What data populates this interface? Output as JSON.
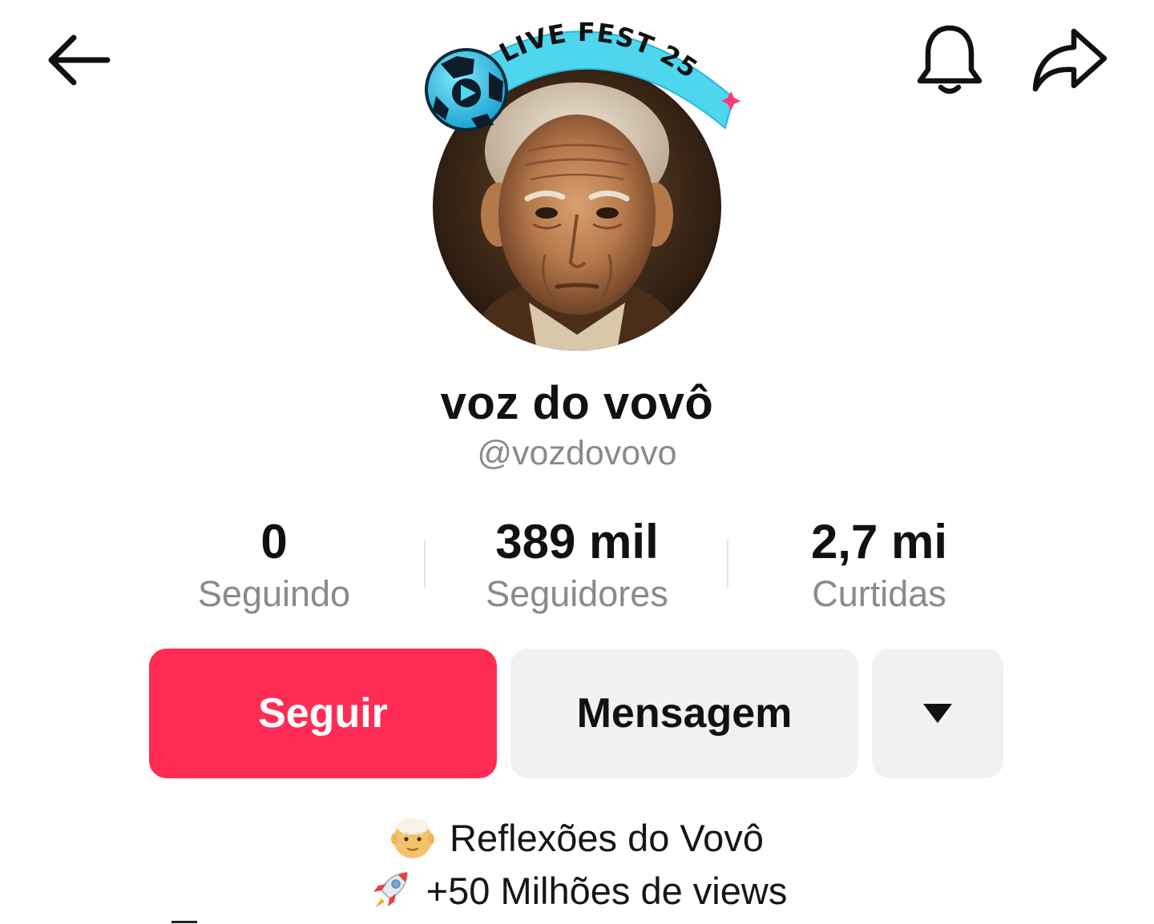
{
  "header": {
    "back_icon": "arrow-left-icon",
    "bell_icon": "bell-icon",
    "share_icon": "share-arrow-icon"
  },
  "avatar": {
    "badge_text": "LIVE FEST 25",
    "badge_color": "#4fd6ef"
  },
  "profile": {
    "display_name": "voz do vovô",
    "handle": "@vozdovovo"
  },
  "stats": [
    {
      "value": "0",
      "label": "Seguindo"
    },
    {
      "value": "389 mil",
      "label": "Seguidores"
    },
    {
      "value": "2,7 mi",
      "label": "Curtidas"
    }
  ],
  "actions": {
    "follow_label": "Seguir",
    "message_label": "Mensagem",
    "more_icon": "caret-down-icon",
    "follow_color": "#fe2c55"
  },
  "bio": {
    "line1_emoji": "older-man-emoji",
    "line1_text": "Reflexões do Vovô",
    "line2_emoji": "rocket-emoji",
    "line2_text": "+50 Milhões de views"
  }
}
